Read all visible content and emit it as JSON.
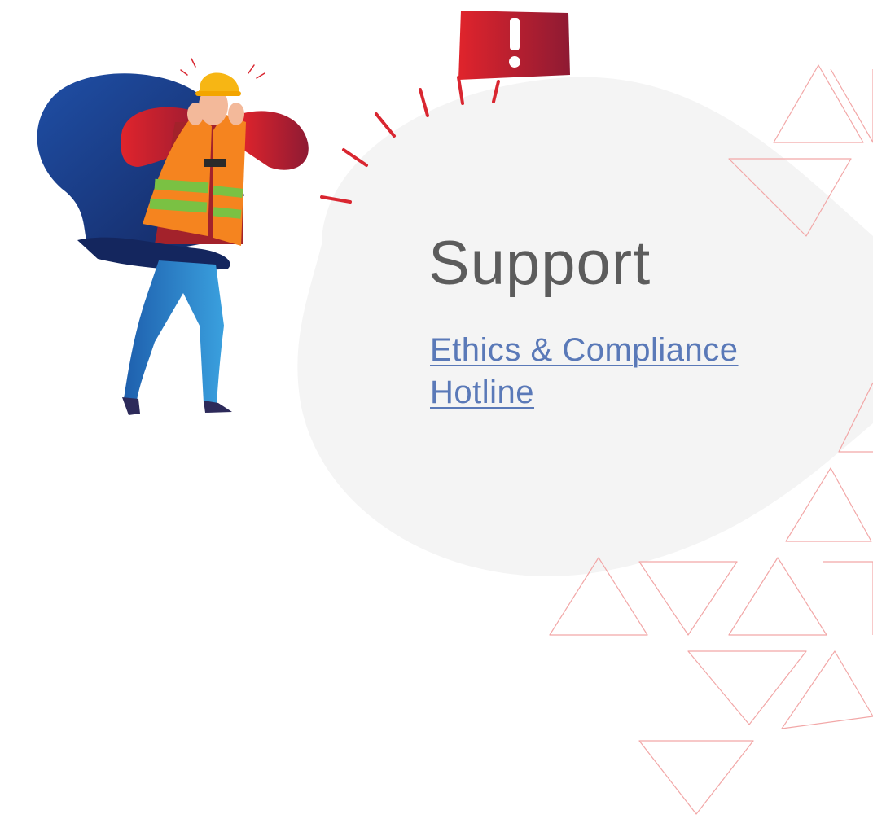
{
  "page": {
    "heading": "Support",
    "link_text": "Ethics & Compliance Hotline"
  },
  "colors": {
    "heading": "#5c5c5c",
    "link": "#5a79b8",
    "blob": "#f4f4f4",
    "triangle_stroke": "#f2a7a7",
    "alert_red": "#c8202a",
    "hair_blue": "#1f3d8a",
    "vest_orange": "#f5841f",
    "stripe_green": "#7ac143",
    "helmet_yellow": "#f7b614",
    "jeans_blue": "#2a7bc4"
  },
  "illustration": {
    "subject": "construction worker covering ears next to an alert sign",
    "alert_icon": "exclamation-icon"
  }
}
